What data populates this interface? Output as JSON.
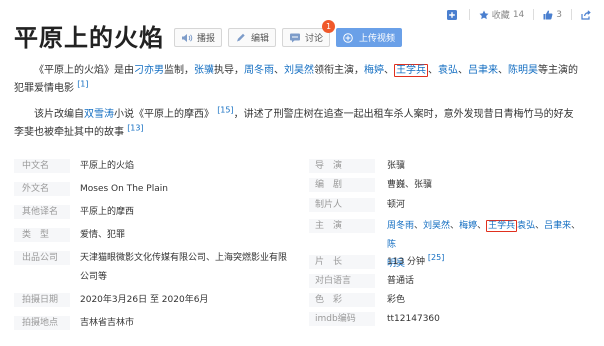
{
  "top_actions": {
    "add_label": "+",
    "favorite": {
      "label": "收藏",
      "count": "14"
    },
    "like": {
      "count": "3"
    }
  },
  "title": "平原上的火焰",
  "buttons": {
    "play": "播报",
    "edit": "编辑",
    "discuss": "讨论",
    "discuss_badge": "1",
    "upload": "上传视频"
  },
  "intro": {
    "pre": "《平原上的火焰》是由",
    "producer": "刁亦男",
    "mid1": "监制，",
    "director": "张骥",
    "mid2": "执导，",
    "cast_a": [
      "周冬雨",
      "刘昊然"
    ],
    "mid3": "领衔主演，",
    "cast_b": [
      "梅婷",
      "王学兵",
      "袁弘",
      "吕聿来",
      "陈明昊"
    ],
    "post": "等主演的",
    "line2": "犯罪爱情电影",
    "ref": "[1]"
  },
  "plot": {
    "pre": "该片改编自",
    "author": "双雪涛",
    "post": "小说《平原上的摩西》",
    "ref1": "[15]",
    "text": "，讲述了刑警庄树在追查一起出租车杀人案时，意外发现昔日青梅竹马的好友",
    "line2": "李斐也被牵扯其中的故事",
    "ref2": "[13]"
  },
  "info_left": [
    {
      "label": "中文名",
      "value": "平原上的火焰"
    },
    {
      "label": "外文名",
      "value": "Moses On The Plain"
    },
    {
      "label": "其他译名",
      "value": "平原上的摩西"
    },
    {
      "label": "类　型",
      "value": "爱情、犯罪"
    },
    {
      "label": "出品公司",
      "value": "天津猫眼微影文化传媒有限公司、上海突燃影业有限",
      "value2": "公司等"
    },
    {
      "label": "拍摄日期",
      "value": "2020年3月26日 至 2020年6月"
    },
    {
      "label": "拍摄地点",
      "value": "吉林省吉林市"
    }
  ],
  "info_right": {
    "director": {
      "label": "导　演",
      "value": "张骥"
    },
    "writer": {
      "label": "编　剧",
      "value": "曹巍、张骥"
    },
    "producer": {
      "label": "制片人",
      "value": "顿河"
    },
    "cast": {
      "label": "主　演",
      "names": [
        "周冬雨",
        "刘昊然",
        "梅婷",
        "王学兵",
        "袁弘",
        "吕聿来",
        "陈",
        "明昊"
      ]
    },
    "length": {
      "label": "片　长",
      "value": "113 分钟",
      "ref": "[25]"
    },
    "language": {
      "label": "对白语言",
      "value": "普通话"
    },
    "color": {
      "label": "色　彩",
      "value": "彩色"
    },
    "imdb": {
      "label": "imdb编码",
      "value": "tt12147360"
    }
  },
  "colors": {
    "link": "#136ec2",
    "highlight_box": "#e0301e",
    "upload_button": "#6aa0e8",
    "badge": "#f0592b"
  }
}
